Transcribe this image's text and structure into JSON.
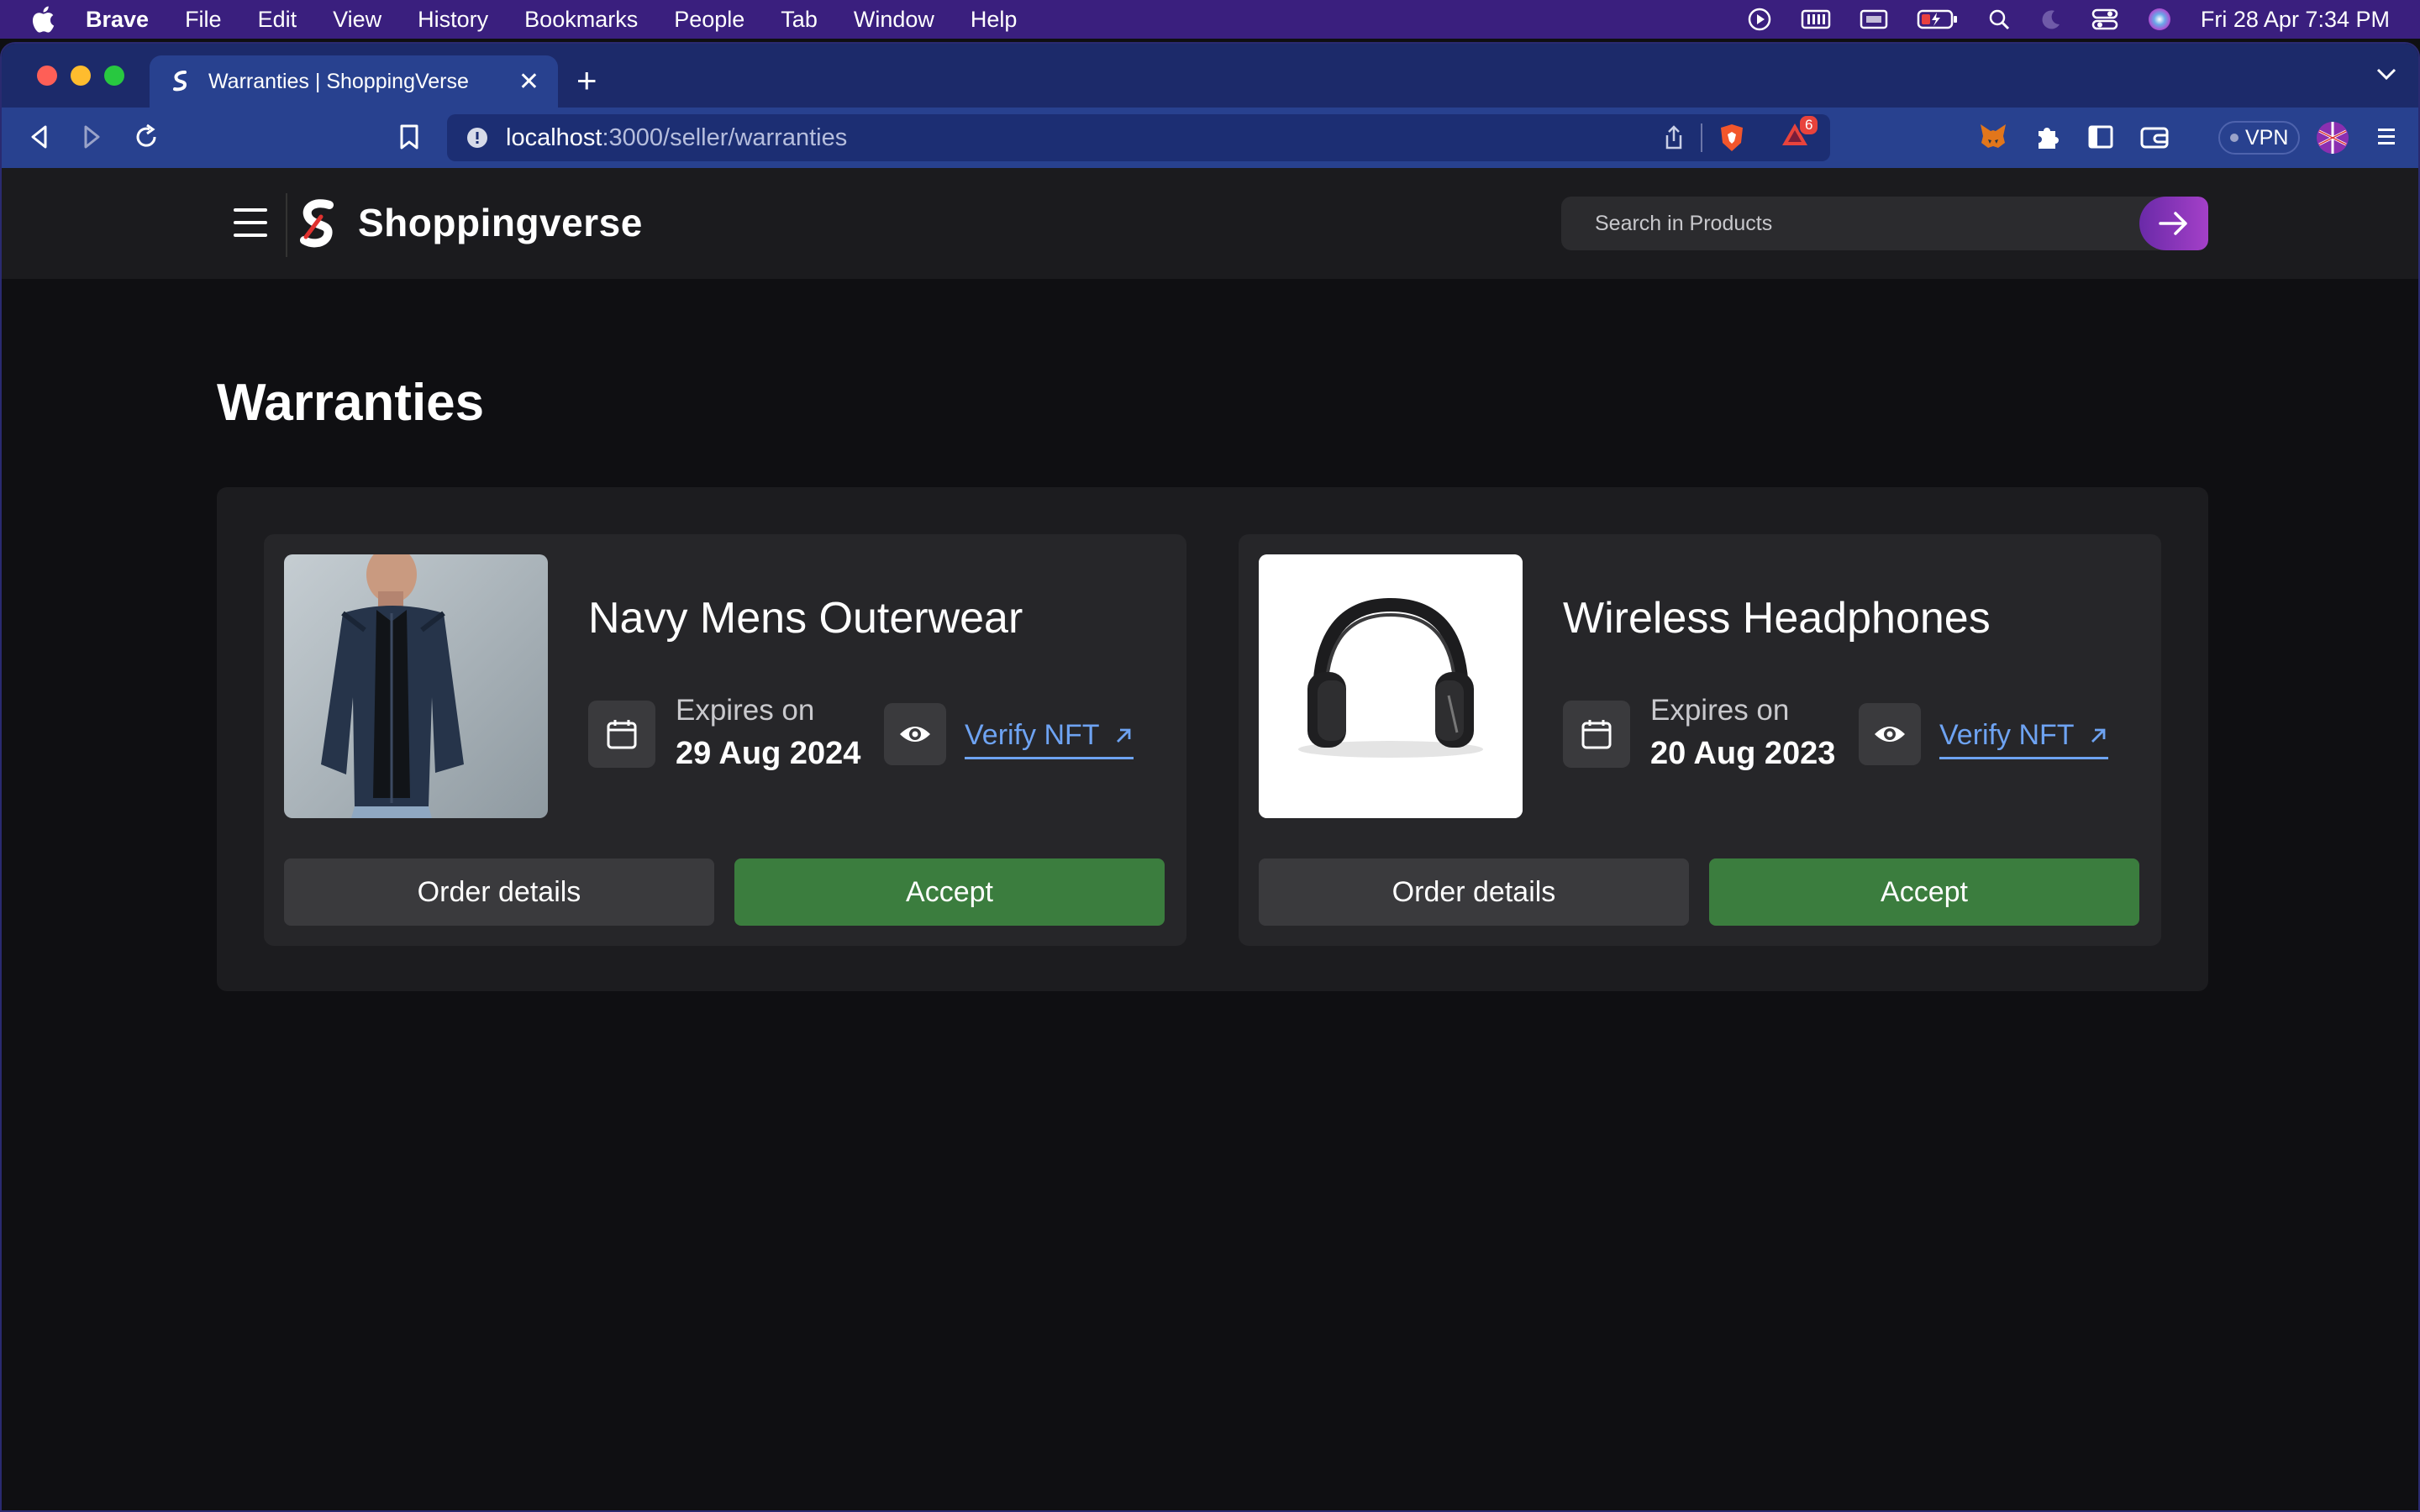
{
  "menubar": {
    "app_name": "Brave",
    "items": [
      "File",
      "Edit",
      "View",
      "History",
      "Bookmarks",
      "People",
      "Tab",
      "Window",
      "Help"
    ],
    "clock": "Fri 28 Apr  7:34 PM",
    "status_icons": [
      "play-icon",
      "memory-icon",
      "display-icon",
      "battery-icon",
      "search-icon",
      "moon-icon",
      "control-center-icon",
      "siri-icon"
    ]
  },
  "browser": {
    "tab_title": "Warranties | ShoppingVerse",
    "url_host": "localhost",
    "url_path": ":3000/seller/warranties",
    "shields_badge": "6",
    "vpn_label": "VPN"
  },
  "app": {
    "brand": "Shoppingverse",
    "search_placeholder": "Search in Products",
    "page_title": "Warranties",
    "warranties": [
      {
        "product_name": "Navy Mens Outerwear",
        "expires_label": "Expires on",
        "expires_date": "29 Aug 2024",
        "verify_label": "Verify NFT",
        "order_details_label": "Order details",
        "accept_label": "Accept"
      },
      {
        "product_name": "Wireless Headphones",
        "expires_label": "Expires on",
        "expires_date": "20 Aug 2023",
        "verify_label": "Verify NFT",
        "order_details_label": "Order details",
        "accept_label": "Accept"
      }
    ]
  },
  "colors": {
    "menubar_bg": "#3a1f7e",
    "tabbar_bg": "#1c2a6a",
    "toolbar_bg": "#28418f",
    "accept_green": "#3b7d3e",
    "link_blue": "#6ea3f2",
    "search_button_gradient": [
      "#6a2aa8",
      "#a440c8"
    ]
  }
}
